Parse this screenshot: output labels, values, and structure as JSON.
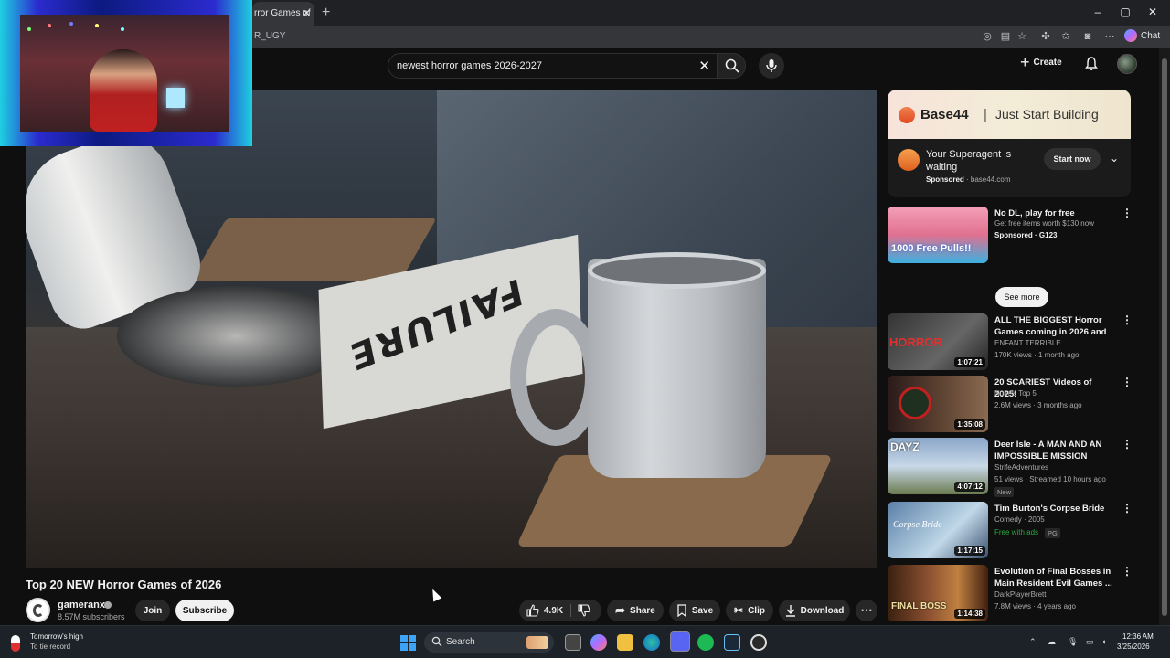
{
  "browser": {
    "tab_title": "rror Games of",
    "url_partial": "R_UGY",
    "chat_label": "Chat"
  },
  "youtube": {
    "search_query": "newest horror games 2026-2027",
    "create_label": "Create"
  },
  "video": {
    "paper_text": "FAILURE",
    "title": "Top 20 NEW Horror Games of 2026",
    "channel": "gameranx",
    "subscribers": "8.57M subscribers",
    "join_label": "Join",
    "subscribe_label": "Subscribe",
    "likes": "4.9K",
    "share_label": "Share",
    "save_label": "Save",
    "clip_label": "Clip",
    "download_label": "Download"
  },
  "ad": {
    "brand": "Base44",
    "divider": "|",
    "tagline": "Just Start Building",
    "card_title": "Your Superagent is waiting",
    "sponsored": "Sponsored",
    "domain": "· base44.com",
    "cta": "Start now"
  },
  "recommendations": [
    {
      "title": "No DL, play for free",
      "line2": "Get free items worth $130 now",
      "line3": "Sponsored · G123",
      "extra": "See more",
      "thumb_text": "1000 Free Pulls!!",
      "colors": [
        "#f4a0b8",
        "#3bb0e0"
      ]
    },
    {
      "title": "ALL THE BIGGEST Horror Games coming in 2026 and ...",
      "line2": "ENFANT TERRIBLE",
      "line3": "170K views · 1 month ago",
      "duration": "1:07:21",
      "thumb_text": "HORROR",
      "colors": [
        "#222",
        "#555"
      ]
    },
    {
      "title": "20 SCARIEST Videos of 2025!",
      "line2": "Nuke's Top 5",
      "line3": "2.6M views · 3 months ago",
      "duration": "1:35:08",
      "colors": [
        "#3a2a2a",
        "#7a6050"
      ]
    },
    {
      "title": "Deer Isle - A MAN AND AN IMPOSSIBLE MISSION",
      "line2": "StrifeAdventures",
      "line3": "51 views · Streamed 10 hours ago",
      "tag": "New",
      "duration": "4:07:12",
      "thumb_text": "DAYZ",
      "colors": [
        "#6a8ab0",
        "#c0d0e0"
      ]
    },
    {
      "title": "Tim Burton's Corpse Bride",
      "line2": "Comedy · 2005",
      "line3": "Free with ads",
      "tag": "PG",
      "duration": "1:17:15",
      "thumb_text": "Corpse Bride",
      "colors": [
        "#7aa0c0",
        "#c0d8e8"
      ]
    },
    {
      "title": "Evolution of Final Bosses in Main Resident Evil Games ...",
      "line2": "DarkPlayerBrett",
      "line3": "7.8M views · 4 years ago",
      "duration": "1:14:38",
      "thumb_text": "FINAL BOSS",
      "colors": [
        "#5a3020",
        "#c08040"
      ]
    }
  ],
  "taskbar": {
    "weather_title": "Tomorrow's high",
    "weather_sub": "To tie record",
    "search_label": "Search",
    "time": "12:36 AM",
    "date": "3/25/2026"
  }
}
